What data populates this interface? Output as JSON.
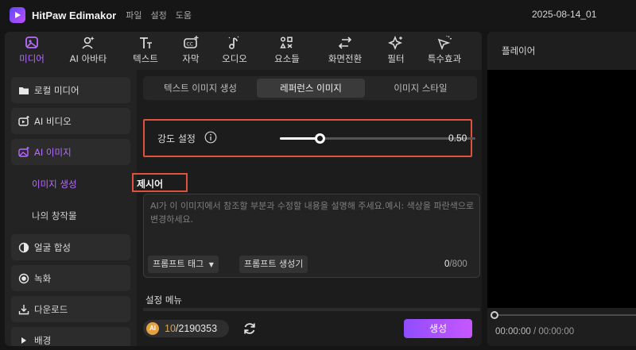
{
  "app": {
    "name": "HitPaw Edimakor",
    "menu": [
      "파일",
      "설정",
      "도움"
    ],
    "project": "2025-08-14_01"
  },
  "toolbar": {
    "items": [
      {
        "label": "미디어",
        "icon": "media-icon",
        "active": true
      },
      {
        "label": "AI 아바타",
        "icon": "avatar-icon"
      },
      {
        "label": "텍스트",
        "icon": "text-icon"
      },
      {
        "label": "자막",
        "icon": "caption-icon"
      },
      {
        "label": "오디오",
        "icon": "audio-icon"
      },
      {
        "label": "요소들",
        "icon": "elements-icon"
      },
      {
        "label": "화면전환",
        "icon": "transition-icon"
      },
      {
        "label": "필터",
        "icon": "filter-icon"
      },
      {
        "label": "특수효과",
        "icon": "effects-icon"
      }
    ]
  },
  "sidebar": {
    "items": [
      {
        "label": "로컬 미디어",
        "icon": "folder-icon"
      },
      {
        "label": "AI 비디오",
        "icon": "ai-video-icon"
      },
      {
        "label": "AI 이미지",
        "icon": "ai-image-icon",
        "active": true
      },
      {
        "label": "얼굴 합성",
        "icon": "face-swap-icon"
      },
      {
        "label": "녹화",
        "icon": "record-icon"
      },
      {
        "label": "다운로드",
        "icon": "download-icon"
      },
      {
        "label": "배경",
        "icon": "triangle-icon"
      }
    ],
    "sub_items": [
      {
        "label": "이미지 생성",
        "active": true
      },
      {
        "label": "나의 창작물"
      }
    ]
  },
  "tabs": [
    {
      "label": "텍스트 이미지 생성"
    },
    {
      "label": "레퍼런스 이미지",
      "active": true
    },
    {
      "label": "이미지 스타일"
    }
  ],
  "strength": {
    "label": "강도 설정",
    "value": "0.50",
    "value_fraction": 0.5
  },
  "prompt": {
    "title": "제시어",
    "placeholder": "AI가 이 이미지에서 참조할 부분과 수정할 내용을 설명해 주세요.예시: 색상을 파란색으로 변경하세요.",
    "tag_button": "프롬프트 태그",
    "generator_button": "프롬프트 생성기",
    "count": "0",
    "max": "/800"
  },
  "settings": {
    "title": "설정 메뉴"
  },
  "footer": {
    "credits_used": "10",
    "credits_total": "/2190353",
    "coin_label": "AI",
    "generate_label": "생성"
  },
  "player": {
    "title": "플레이어",
    "current_time": "00:00:00",
    "total_time": " / 00:00:00"
  },
  "colors": {
    "accent": "#b66bff",
    "highlight_border": "#e0503f",
    "generate_gradient_start": "#8f4dff",
    "generate_gradient_end": "#c757ff",
    "coin": "#e6a23c"
  }
}
